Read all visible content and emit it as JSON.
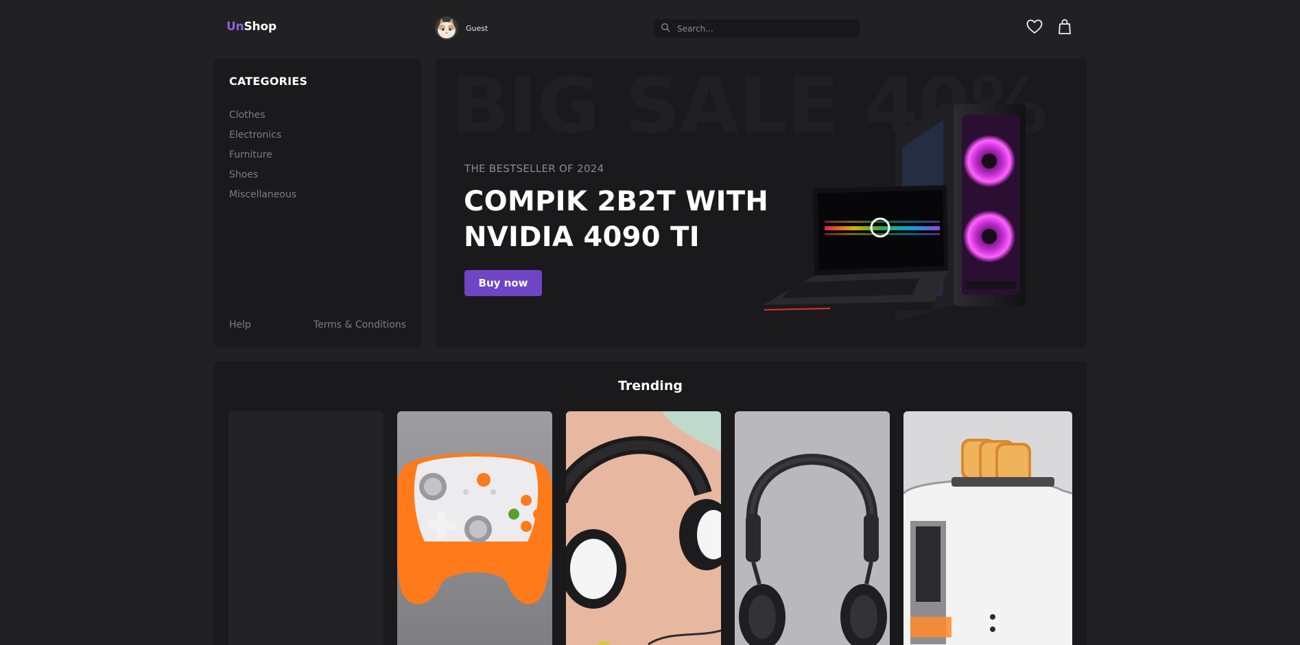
{
  "header": {
    "logo_part1": "Un",
    "logo_part2": "Shop",
    "user_name": "Guest",
    "search_placeholder": "Search...",
    "icons": [
      "search-icon",
      "heart-icon",
      "shopping-bag-icon"
    ]
  },
  "sidebar": {
    "title": "CATEGORIES",
    "items": [
      {
        "label": "Clothes"
      },
      {
        "label": "Electronics"
      },
      {
        "label": "Furniture"
      },
      {
        "label": "Shoes"
      },
      {
        "label": "Miscellaneous"
      }
    ],
    "footer": {
      "help": "Help",
      "terms": "Terms & Conditions"
    }
  },
  "banner": {
    "background_text": "BIG SALE 40%",
    "subtitle": "THE BESTSELLER OF 2024",
    "title": "COMPIK 2B2T WITH NVIDIA 4090 TI",
    "button": "Buy now"
  },
  "trending": {
    "title": "Trending",
    "cards": [
      {
        "product": "placeholder"
      },
      {
        "product": "game-controller"
      },
      {
        "product": "headphones-white"
      },
      {
        "product": "headphones-black"
      },
      {
        "product": "toaster"
      }
    ]
  },
  "colors": {
    "background": "#212124",
    "panel": "#1a1a1c",
    "accent": "#6f45c6",
    "logo_accent": "#8f62d9",
    "muted_text": "#7d7d83"
  }
}
